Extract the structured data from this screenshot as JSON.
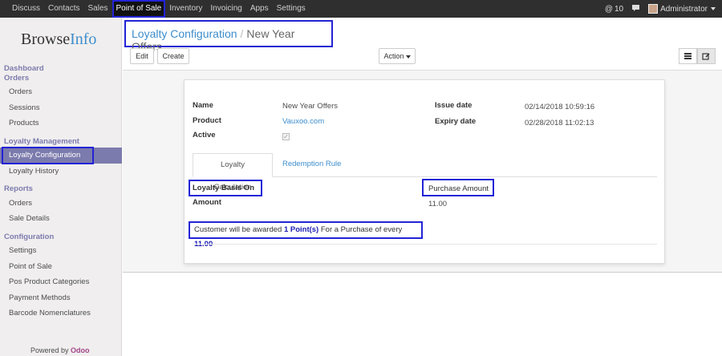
{
  "topbar": {
    "menu": [
      "Discuss",
      "Contacts",
      "Sales",
      "Point of Sale",
      "Inventory",
      "Invoicing",
      "Apps",
      "Settings"
    ],
    "active_menu": "Point of Sale",
    "messages_count": "10",
    "user": "Administrator"
  },
  "sidebar": {
    "logo_browse": "Browse",
    "logo_info": "Info",
    "sections": {
      "dashboard": "Dashboard",
      "orders": "Orders",
      "loyalty": "Loyalty Management",
      "reports": "Reports",
      "configuration": "Configuration"
    },
    "orders_items": [
      "Orders",
      "Sessions",
      "Products"
    ],
    "loyalty_items": [
      "Loyalty Configuration",
      "Loyalty History"
    ],
    "reports_items": [
      "Orders",
      "Sale Details"
    ],
    "config_items": [
      "Settings",
      "Point of Sale",
      "Pos Product Categories",
      "Payment Methods",
      "Barcode Nomenclatures"
    ],
    "powered_by": "Powered by",
    "powered_brand": "Odoo"
  },
  "control_panel": {
    "breadcrumb_parent": "Loyalty Configuration",
    "breadcrumb_sep": "/",
    "breadcrumb_current": "New Year Offers",
    "edit_label": "Edit",
    "create_label": "Create",
    "action_label": "Action"
  },
  "form": {
    "name_label": "Name",
    "name_value": "New Year Offers",
    "product_label": "Product",
    "product_value": "Vauxoo.com",
    "active_label": "Active",
    "active_value": true,
    "issue_label": "Issue date",
    "issue_value": "02/14/2018 10:59:16",
    "expiry_label": "Expiry date",
    "expiry_value": "02/28/2018 11:02:13",
    "tabs": [
      "Loyalty Calculation",
      "Redemption Rule"
    ],
    "basis_label": "Loyalty Basis On",
    "basis_value": "Purchase Amount",
    "amount_label": "Amount",
    "amount_value": "11.00",
    "award_prefix": "Customer will be awarded",
    "award_points": "1 Point(s)",
    "award_middle": "For a Purchase of every",
    "award_amount": "11.00"
  },
  "colors": {
    "accent": "#7c7bad",
    "link": "#3c8dcc",
    "highlight_box": "#2323d6",
    "topbar": "#2f2f2f"
  }
}
